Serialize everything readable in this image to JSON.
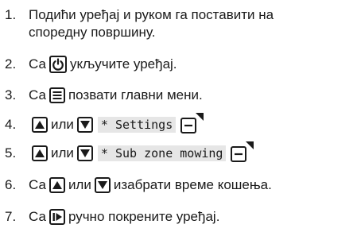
{
  "steps": [
    {
      "num": "1.",
      "lines": [
        "Подићи уређај и руком га поставити на",
        "споредну површину."
      ]
    },
    {
      "num": "2.",
      "before": "Са",
      "icon": "power-icon",
      "after": "укључите уређај."
    },
    {
      "num": "3.",
      "before": "Са",
      "icon": "menu-icon",
      "after": "позвати главни мени."
    },
    {
      "num": "4.",
      "or_text": "или",
      "code": "* Settings",
      "icon_up": "arrow-up-icon",
      "icon_down": "arrow-down-icon",
      "icon_end": "minus-key-icon"
    },
    {
      "num": "5.",
      "or_text": "или",
      "code": "* Sub zone mowing",
      "icon_up": "arrow-up-icon",
      "icon_down": "arrow-down-icon",
      "icon_end": "minus-key-icon"
    },
    {
      "num": "6.",
      "before": "Са",
      "or_text": "или",
      "after": "изабрати време кошења.",
      "icon_up": "arrow-up-icon",
      "icon_down": "arrow-down-icon"
    },
    {
      "num": "7.",
      "before": "Са",
      "icon": "play-start-icon",
      "after": "ручно покрените уређај."
    }
  ]
}
